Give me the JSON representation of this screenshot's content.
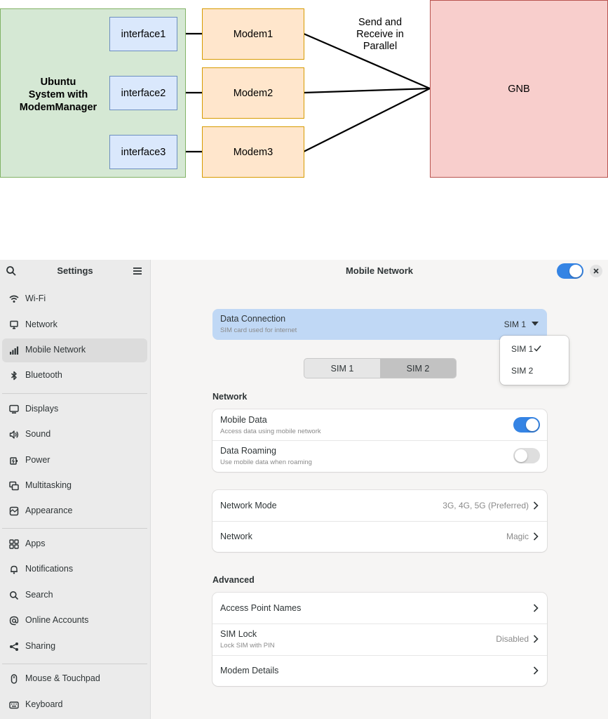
{
  "diagram": {
    "ubuntu_label": [
      "Ubuntu",
      "System with",
      "ModemManager"
    ],
    "interfaces": [
      "interface1",
      "interface2",
      "interface3"
    ],
    "modems": [
      "Modem1",
      "Modem2",
      "Modem3"
    ],
    "parallel_label": [
      "Send and",
      "Receive in",
      "Parallel"
    ],
    "gnb_label": "GNB",
    "colors": {
      "ubuntu_fill": "#d5e8d4",
      "interface_fill": "#dae8fc",
      "modem_fill": "#ffe6cc",
      "gnb_fill": "#f8cecc"
    }
  },
  "window": {
    "sidebar_title": "Settings",
    "main_title": "Mobile Network",
    "main_toggle_on": true,
    "sidebar": {
      "items": [
        {
          "label": "Wi-Fi",
          "icon": "wifi-icon"
        },
        {
          "label": "Network",
          "icon": "network-icon"
        },
        {
          "label": "Mobile Network",
          "icon": "signal-icon",
          "active": true
        },
        {
          "label": "Bluetooth",
          "icon": "bluetooth-icon"
        },
        {
          "label": "Displays",
          "icon": "display-icon"
        },
        {
          "label": "Sound",
          "icon": "speaker-icon"
        },
        {
          "label": "Power",
          "icon": "power-icon"
        },
        {
          "label": "Multitasking",
          "icon": "multitasking-icon"
        },
        {
          "label": "Appearance",
          "icon": "appearance-icon"
        },
        {
          "label": "Apps",
          "icon": "apps-icon"
        },
        {
          "label": "Notifications",
          "icon": "bell-icon"
        },
        {
          "label": "Search",
          "icon": "search-icon"
        },
        {
          "label": "Online Accounts",
          "icon": "at-icon"
        },
        {
          "label": "Sharing",
          "icon": "share-icon"
        },
        {
          "label": "Mouse & Touchpad",
          "icon": "mouse-icon"
        },
        {
          "label": "Keyboard",
          "icon": "keyboard-icon"
        }
      ]
    },
    "data_connection": {
      "title": "Data Connection",
      "subtitle": "SIM card used for internet",
      "value": "SIM 1"
    },
    "sim_dropdown": {
      "options": [
        "SIM 1",
        "SIM 2"
      ],
      "checked": "SIM 1"
    },
    "sim_tabs": {
      "options": [
        "SIM 1",
        "SIM 2"
      ],
      "selected": "SIM 2"
    },
    "network_section": {
      "label": "Network",
      "mobile_data": {
        "title": "Mobile Data",
        "subtitle": "Access data using mobile network",
        "on": true
      },
      "data_roaming": {
        "title": "Data Roaming",
        "subtitle": "Use mobile data when roaming",
        "on": false
      }
    },
    "network_mode": {
      "title": "Network Mode",
      "value": "3G, 4G, 5G (Preferred)"
    },
    "network": {
      "title": "Network",
      "value": "Magic"
    },
    "advanced_section": {
      "label": "Advanced",
      "apn": {
        "title": "Access Point Names"
      },
      "sim_lock": {
        "title": "SIM Lock",
        "subtitle": "Lock SIM with PIN",
        "value": "Disabled"
      },
      "modem_details": {
        "title": "Modem Details"
      }
    },
    "accent_color": "#3584e4"
  }
}
